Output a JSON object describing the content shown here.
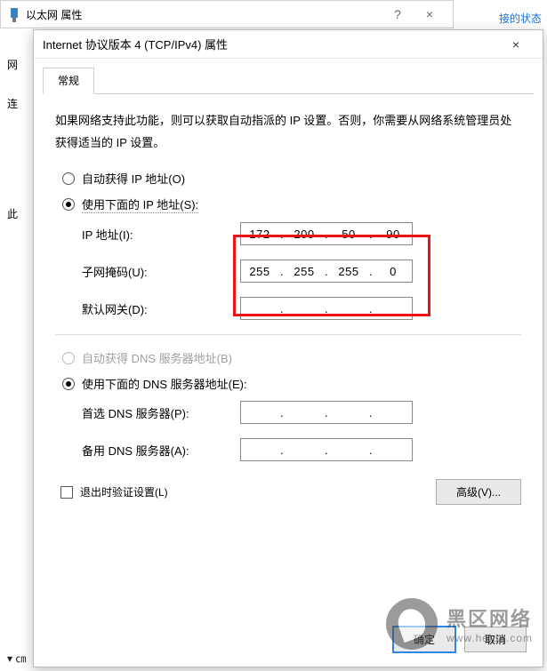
{
  "background": {
    "right_link": "接的状态",
    "side_net": "网",
    "side_conn": "连",
    "side_this": "此",
    "bottom_cut": "▾ ㎝"
  },
  "outer": {
    "title": "以太网 属性",
    "close": "×"
  },
  "inner": {
    "title": "Internet 协议版本 4 (TCP/IPv4) 属性",
    "close": "×",
    "tab": "常规",
    "description": "如果网络支持此功能，则可以获取自动指派的 IP 设置。否则，你需要从网络系统管理员处获得适当的 IP 设置。",
    "opt_auto_ip": "自动获得 IP 地址(O)",
    "opt_manual_ip": "使用下面的 IP 地址(S):",
    "field_ip": "IP 地址(I):",
    "field_mask": "子网掩码(U):",
    "field_gateway": "默认网关(D):",
    "ip": {
      "a": "172",
      "b": "200",
      "c": "50",
      "d": "90"
    },
    "mask": {
      "a": "255",
      "b": "255",
      "c": "255",
      "d": "0"
    },
    "opt_auto_dns": "自动获得 DNS 服务器地址(B)",
    "opt_manual_dns": "使用下面的 DNS 服务器地址(E):",
    "field_dns1": "首选 DNS 服务器(P):",
    "field_dns2": "备用 DNS 服务器(A):",
    "validate": "退出时验证设置(L)",
    "advanced": "高级(V)...",
    "ok": "确定",
    "cancel": "取消"
  },
  "watermark": {
    "line1": "黑区网络",
    "line2": "www.heiqu.com"
  }
}
